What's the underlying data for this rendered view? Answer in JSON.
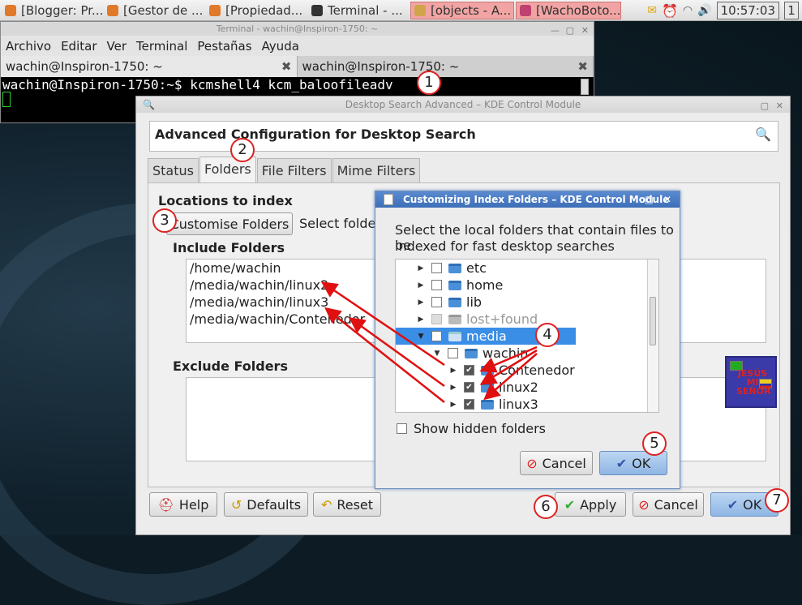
{
  "taskbar": {
    "tasks": [
      {
        "label": "[Blogger: Pr...",
        "color": "#e07a2a"
      },
      {
        "label": "[Gestor de ...",
        "color": "#e07a2a"
      },
      {
        "label": "[Propiedad...",
        "color": "#e07a2a"
      },
      {
        "label": "Terminal - ...",
        "color": "#333333"
      },
      {
        "label": "[objects - A...",
        "color": "#cfa44a"
      },
      {
        "label": "[WachoBoto...",
        "color": "#c04070"
      }
    ],
    "clock": "10:57:03",
    "desktop": "1"
  },
  "terminal": {
    "title": "Terminal - wachin@Inspiron-1750: ~",
    "menu": [
      "Archivo",
      "Editar",
      "Ver",
      "Terminal",
      "Pestañas",
      "Ayuda"
    ],
    "tabs": [
      "wachin@Inspiron-1750: ~",
      "wachin@Inspiron-1750: ~"
    ],
    "command_line": "wachin@Inspiron-1750:~$ kcmshell4 kcm_baloofileadv"
  },
  "main_dialog": {
    "title": "Desktop Search Advanced – KDE Control Module",
    "header": "Advanced Configuration for Desktop Search",
    "tabs": [
      "Status",
      "Folders",
      "File Filters",
      "Mime Filters"
    ],
    "locations_label": "Locations to index",
    "customise_button": "Customise Folders",
    "select_folders_text": "Select folders",
    "include_label": "Include Folders",
    "include_folders": [
      "/home/wachin",
      "/media/wachin/linux2",
      "/media/wachin/linux3",
      "/media/wachin/Contenedor"
    ],
    "exclude_label": "Exclude Folders",
    "buttons": {
      "help": "Help",
      "defaults": "Defaults",
      "reset": "Reset",
      "apply": "Apply",
      "cancel": "Cancel",
      "ok": "OK"
    }
  },
  "sub_dialog": {
    "title": "Customizing Index Folders – KDE Control Module",
    "description_1": "Select the local folders that contain files to be",
    "description_2": "indexed for fast desktop searches",
    "tree": [
      {
        "label": "etc",
        "checked": false
      },
      {
        "label": "home",
        "checked": false
      },
      {
        "label": "lib",
        "checked": false
      },
      {
        "label": "lost+found",
        "checked": false
      },
      {
        "label": "media",
        "checked": false
      },
      {
        "label": "wachin",
        "checked": false
      },
      {
        "label": "Contenedor",
        "checked": true
      },
      {
        "label": "linux2",
        "checked": true
      },
      {
        "label": "linux3",
        "checked": true
      }
    ],
    "show_hidden": "Show hidden folders",
    "cancel": "Cancel",
    "ok": "OK"
  },
  "annotations": [
    "1",
    "2",
    "3",
    "4",
    "5",
    "6",
    "7"
  ],
  "logo_text": "JESÚS MI SEÑOR"
}
